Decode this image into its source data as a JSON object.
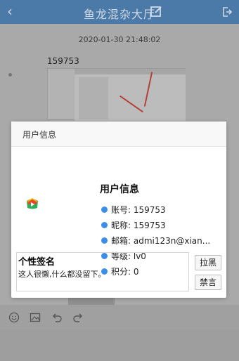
{
  "header": {
    "title": "鱼龙混杂大厅",
    "back_glyph": "‹",
    "icons": [
      "back-icon",
      "edit-icon",
      "exit-icon"
    ]
  },
  "chat": {
    "timestamp": "2020-01-30 21:48:02",
    "sender": "159753"
  },
  "toolbar": {
    "icons": [
      "emoji-icon",
      "image-icon",
      "undo-icon",
      "redo-icon"
    ]
  },
  "modal": {
    "header_title": "用户信息",
    "info_title": "用户信息",
    "fields": {
      "account": "账号: 159753",
      "nickname": "昵称: 159753",
      "email": "邮箱: admi123n@xian...",
      "level": "等级: lv0",
      "points": "积分: 0"
    },
    "signature_title": "个性签名",
    "signature_text": "这人很懒,什么都没留下。",
    "block_label": "拉黑",
    "mute_label": "禁言"
  },
  "colors": {
    "header": "#4c7aa8",
    "bullet": "#3b8ee8",
    "overlay": "#9a9a9a"
  }
}
